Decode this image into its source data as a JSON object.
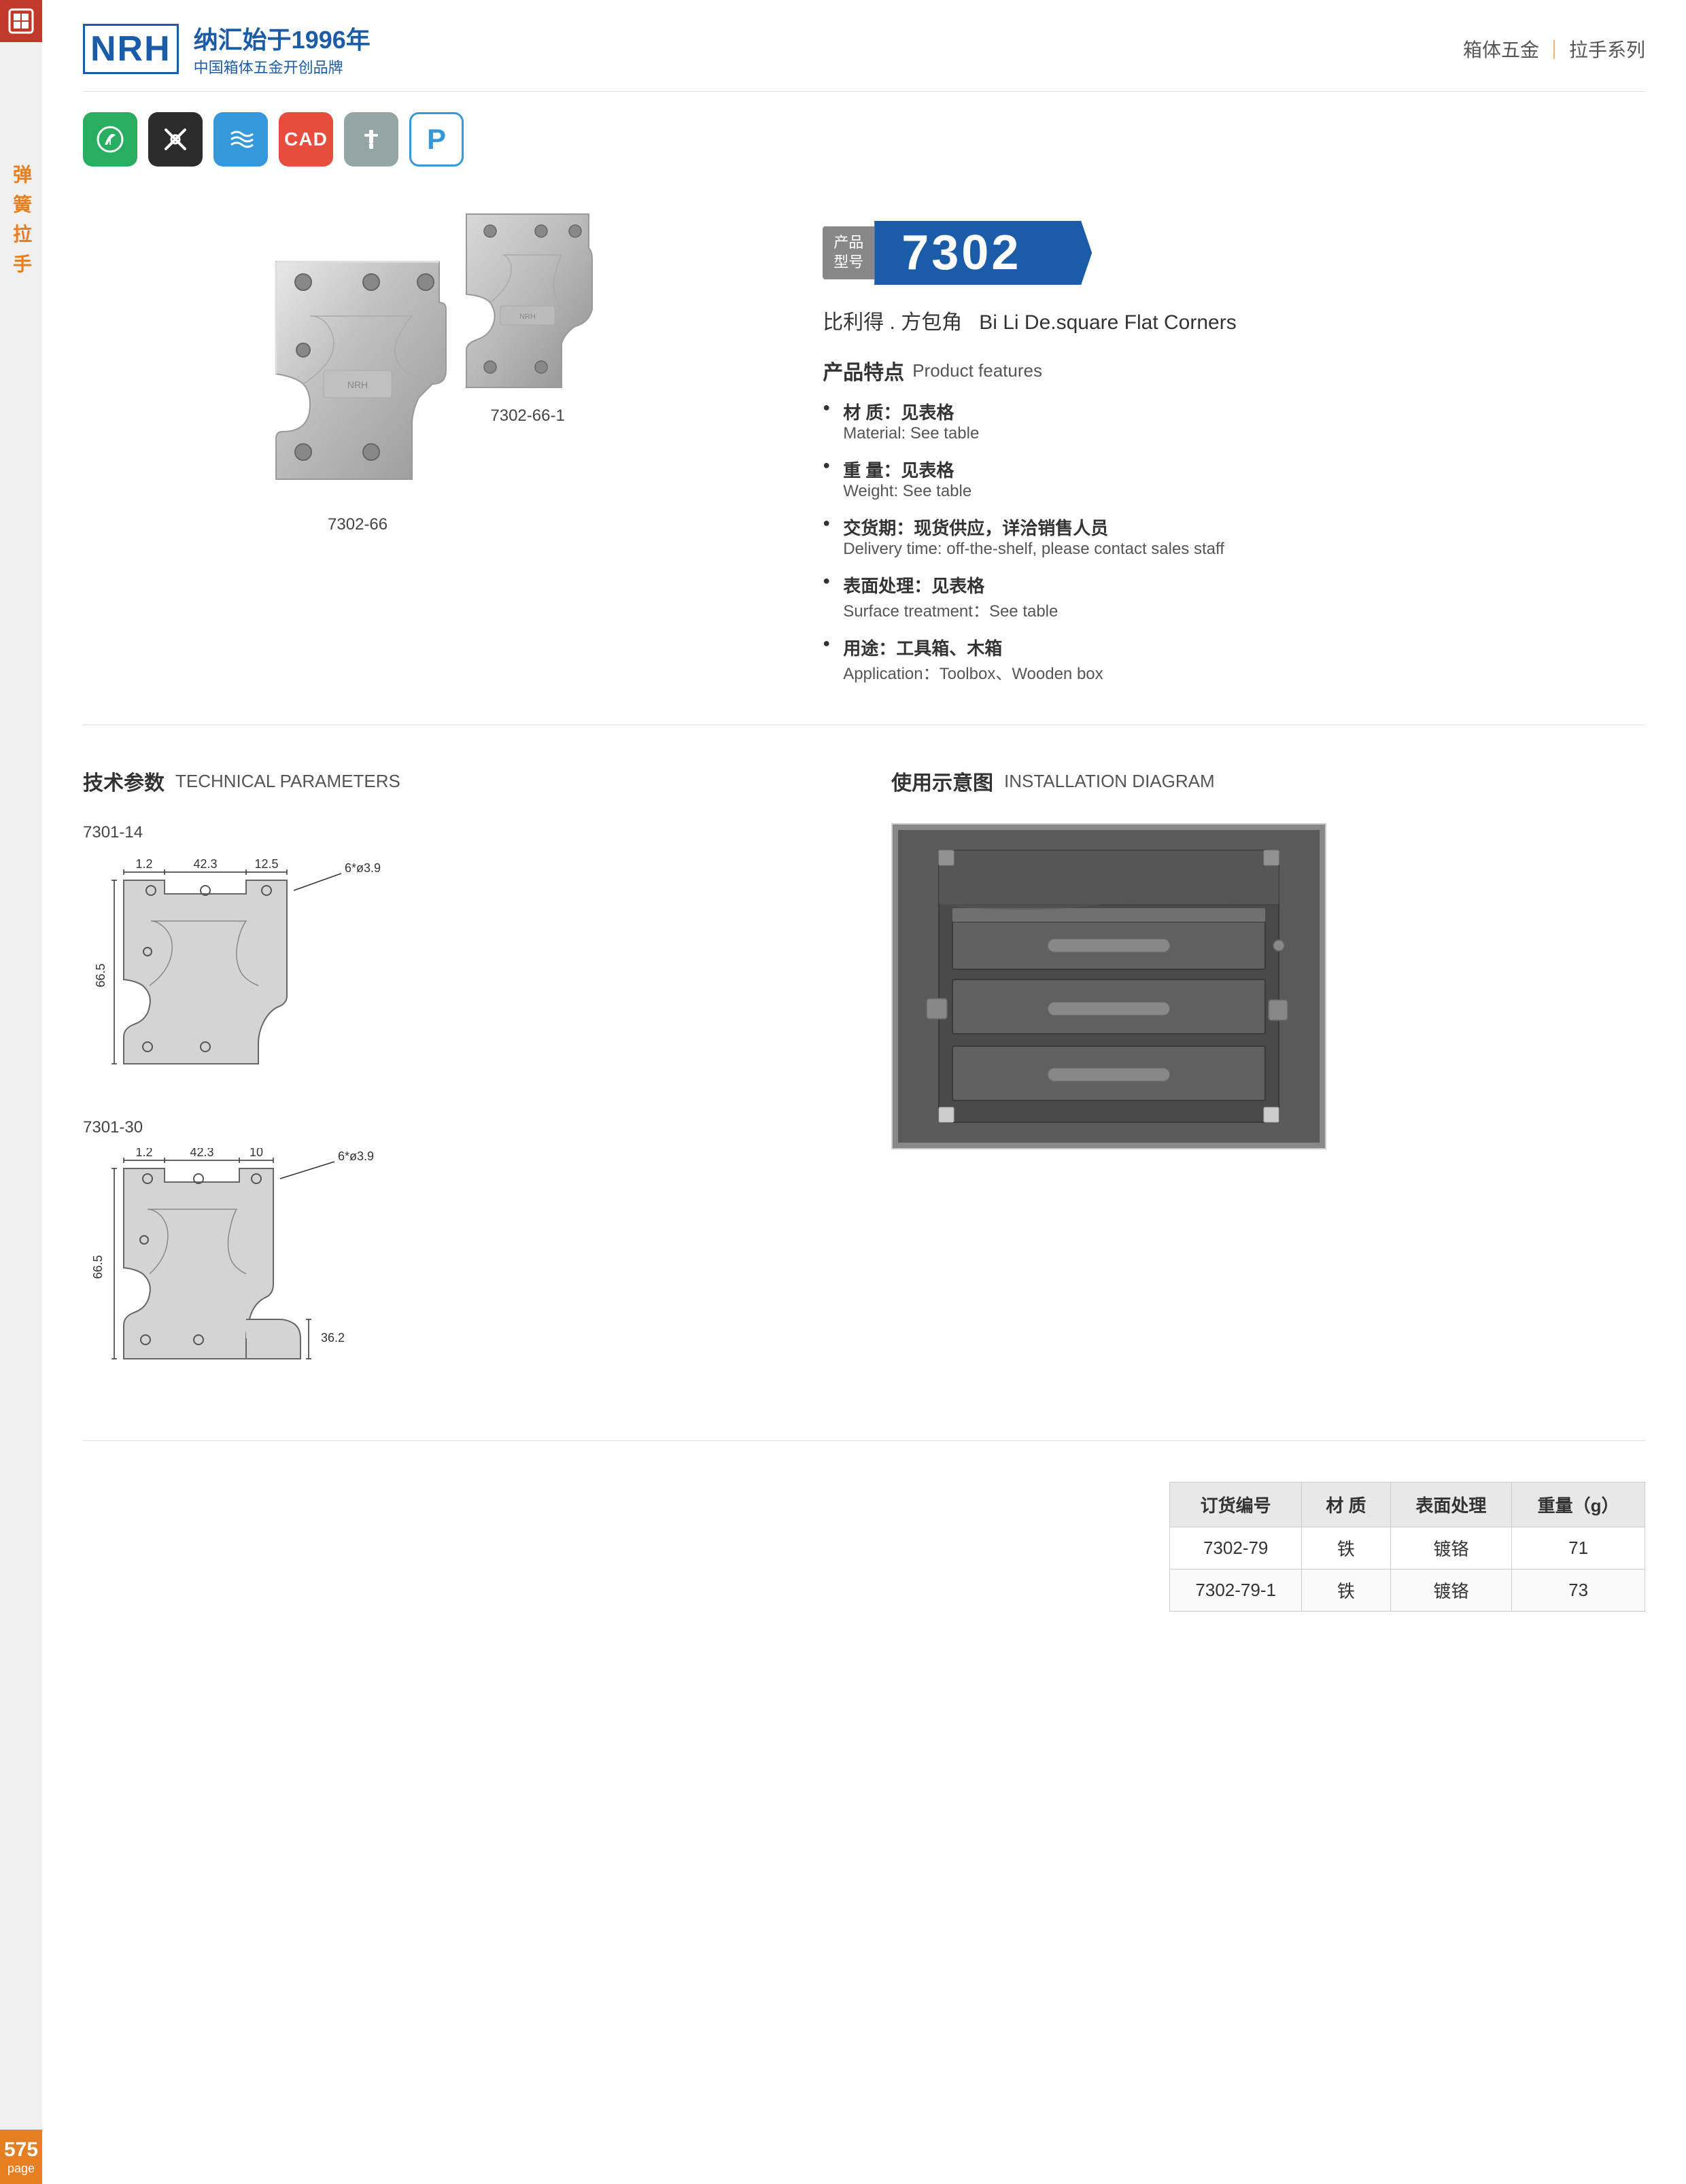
{
  "sidebar": {
    "logo_text": "NRH",
    "category_text": "弹\n簧\n拉\n手"
  },
  "header": {
    "logo_nrh": "NRH",
    "logo_tagline_cn": "纳汇始于1996年",
    "logo_tagline_sub": "中国箱体五金开创品牌",
    "category": "箱体五金",
    "series": "拉手系列"
  },
  "toolbar": {
    "icons": [
      {
        "id": "eco",
        "label": "♻",
        "style": "green"
      },
      {
        "id": "tool",
        "label": "✂",
        "style": "dark"
      },
      {
        "id": "spring",
        "label": "≋",
        "style": "blue"
      },
      {
        "id": "cad",
        "label": "CAD",
        "style": "red"
      },
      {
        "id": "pin",
        "label": "T",
        "style": "gray"
      },
      {
        "id": "p",
        "label": "P",
        "style": "outline"
      }
    ]
  },
  "product": {
    "number": "7302",
    "label_line1": "产品",
    "label_line2": "型号",
    "name_cn": "比利得 . 方包角",
    "name_en": "Bi Li De.square Flat Corners",
    "image_large_caption": "7302-66",
    "image_small_caption": "7302-66-1",
    "features_title_cn": "产品特点",
    "features_title_en": "Product features",
    "features": [
      {
        "cn": "材  质：见表格",
        "en": "Material: See table"
      },
      {
        "cn": "重  量：见表格",
        "en": "Weight: See table"
      },
      {
        "cn": "交货期：现货供应，详洽销售人员",
        "en": "Delivery time: off-the-shelf, please contact sales staff"
      },
      {
        "cn": "表面处理：见表格",
        "en": "Surface treatment：See table"
      },
      {
        "cn": "用途：工具箱、木箱",
        "en": "Application：Toolbox、Wooden box"
      }
    ]
  },
  "technical": {
    "title_cn": "技术参数",
    "title_en": "TECHNICAL PARAMETERS",
    "diagrams": [
      {
        "label": "7301-14",
        "dims": {
          "w1": "1.2",
          "w2": "42.3",
          "w3": "12.5",
          "h1": "66.5",
          "hole": "6*ø3.9"
        }
      },
      {
        "label": "7301-30",
        "dims": {
          "w1": "1.2",
          "w2": "42.3",
          "w3": "10",
          "h1": "66.5",
          "h2": "36.2",
          "hole": "6*ø3.9"
        }
      }
    ]
  },
  "installation": {
    "title_cn": "使用示意图",
    "title_en": "INSTALLATION DIAGRAM"
  },
  "table": {
    "headers": [
      "订货编号",
      "材  质",
      "表面处理",
      "重量（g）"
    ],
    "rows": [
      [
        "7302-79",
        "铁",
        "镀铬",
        "71"
      ],
      [
        "7302-79-1",
        "铁",
        "镀铬",
        "73"
      ]
    ]
  },
  "footer": {
    "page_number": "575",
    "page_label": "page"
  }
}
